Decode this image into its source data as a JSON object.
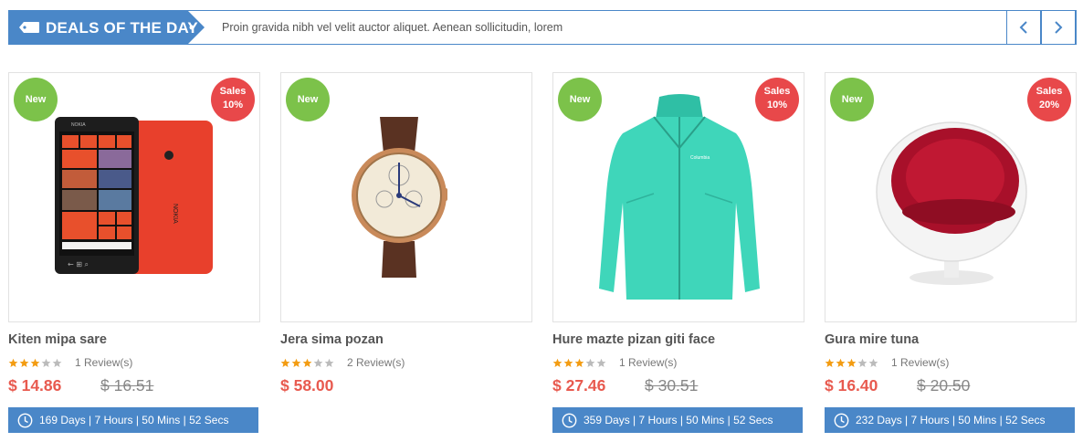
{
  "deals": {
    "title": "DEALS OF THE DAY",
    "ticker": "Proin gravida nibh vel velit auctor aliquet. Aenean sollicitudin, lorem",
    "prev_icon": "chevron-left-icon",
    "next_icon": "chevron-right-icon"
  },
  "colors": {
    "accent": "#4a87c8",
    "new_badge": "#7cc24a",
    "sale_badge": "#e8484a",
    "price": "#e85a4f",
    "star_filled": "#f39c12",
    "star_empty": "#bbbbbb"
  },
  "products": [
    {
      "name": "Kiten mipa sare",
      "badge_new": "New",
      "badge_sale_line1": "Sales",
      "badge_sale_line2": "10%",
      "rating": 3,
      "reviews": "1 Review(s)",
      "price": "$ 14.86",
      "old_price": "$ 16.51",
      "timer": "169 Days | 7 Hours | 50 Mins | 52 Secs",
      "image": "red-smartphone"
    },
    {
      "name": "Jera sima pozan",
      "badge_new": "New",
      "rating": 3,
      "reviews": "2 Review(s)",
      "price": "$ 58.00",
      "image": "wrist-watch"
    },
    {
      "name": "Hure mazte pizan giti face",
      "badge_new": "New",
      "badge_sale_line1": "Sales",
      "badge_sale_line2": "10%",
      "rating": 3,
      "reviews": "1 Review(s)",
      "price": "$ 27.46",
      "old_price": "$ 30.51",
      "timer": "359 Days | 7 Hours | 50 Mins | 52 Secs",
      "image": "teal-jacket"
    },
    {
      "name": "Gura mire tuna",
      "badge_new": "New",
      "badge_sale_line1": "Sales",
      "badge_sale_line2": "20%",
      "rating": 3,
      "reviews": "1 Review(s)",
      "price": "$ 16.40",
      "old_price": "$ 20.50",
      "timer": "232 Days | 7 Hours | 50 Mins | 52 Secs",
      "image": "ball-chair"
    }
  ]
}
